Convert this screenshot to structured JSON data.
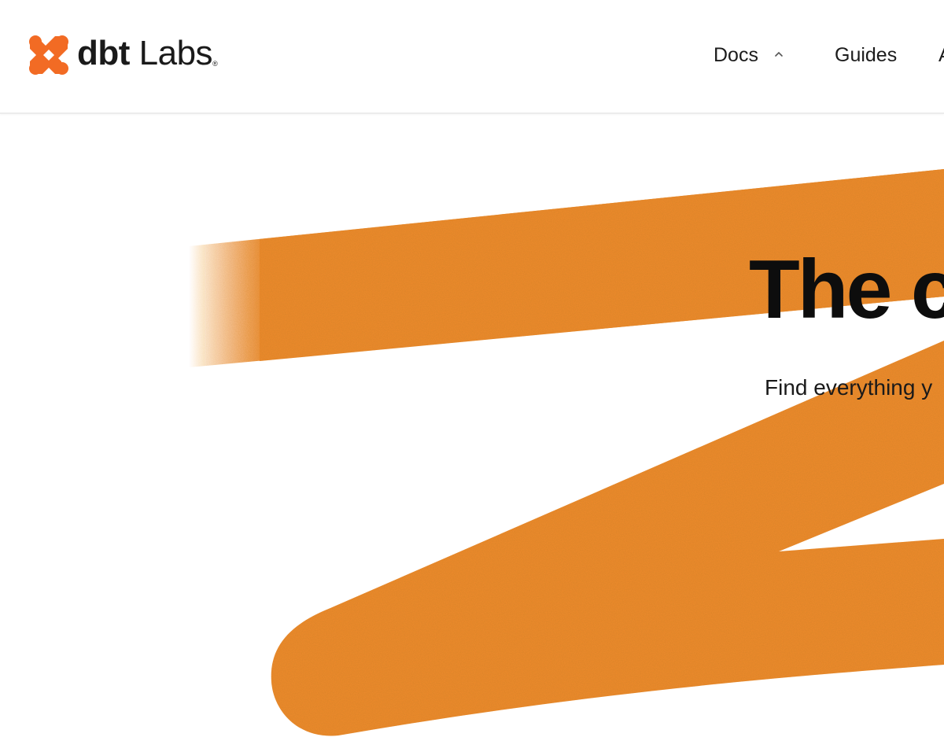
{
  "brand": {
    "logo_text_bold": "dbt",
    "logo_text_light": "Labs",
    "trademark": "®",
    "logo_icon": "dbt-logo-icon",
    "accent_color": "#f26b24",
    "swoosh_color": "#f08a2e"
  },
  "nav": {
    "items": [
      {
        "label": "Docs",
        "icon": "chevron-up-icon"
      },
      {
        "label": "Guides"
      },
      {
        "label": "A"
      }
    ]
  },
  "hero": {
    "title": "The c",
    "subtitle": "Find everything y"
  }
}
